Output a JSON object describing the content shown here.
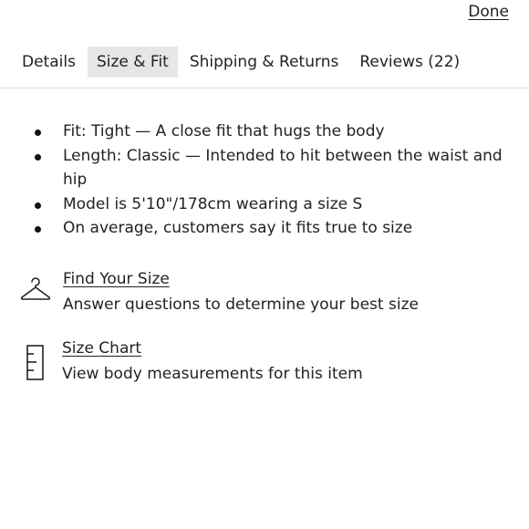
{
  "header": {
    "done_label": "Done"
  },
  "tabs": [
    {
      "label": "Details",
      "active": false
    },
    {
      "label": "Size & Fit",
      "active": true
    },
    {
      "label": "Shipping & Returns",
      "active": false
    },
    {
      "label": "Reviews (22)",
      "active": false
    }
  ],
  "fit_bullets": [
    "Fit: Tight — A close fit that hugs the body",
    "Length: Classic — Intended to hit between the waist and hip",
    "Model is 5'10\"/178cm wearing a size S",
    "On average, customers say it fits true to size"
  ],
  "find_your_size": {
    "icon": "hanger-icon",
    "link_label": "Find Your Size",
    "description": "Answer questions to determine your best size"
  },
  "size_chart": {
    "icon": "ruler-icon",
    "link_label": "Size Chart",
    "description": "View body measurements for this item"
  },
  "colors": {
    "text": "#222222",
    "active_tab_bg": "#e6e6e6",
    "divider": "#dcdcdc"
  }
}
